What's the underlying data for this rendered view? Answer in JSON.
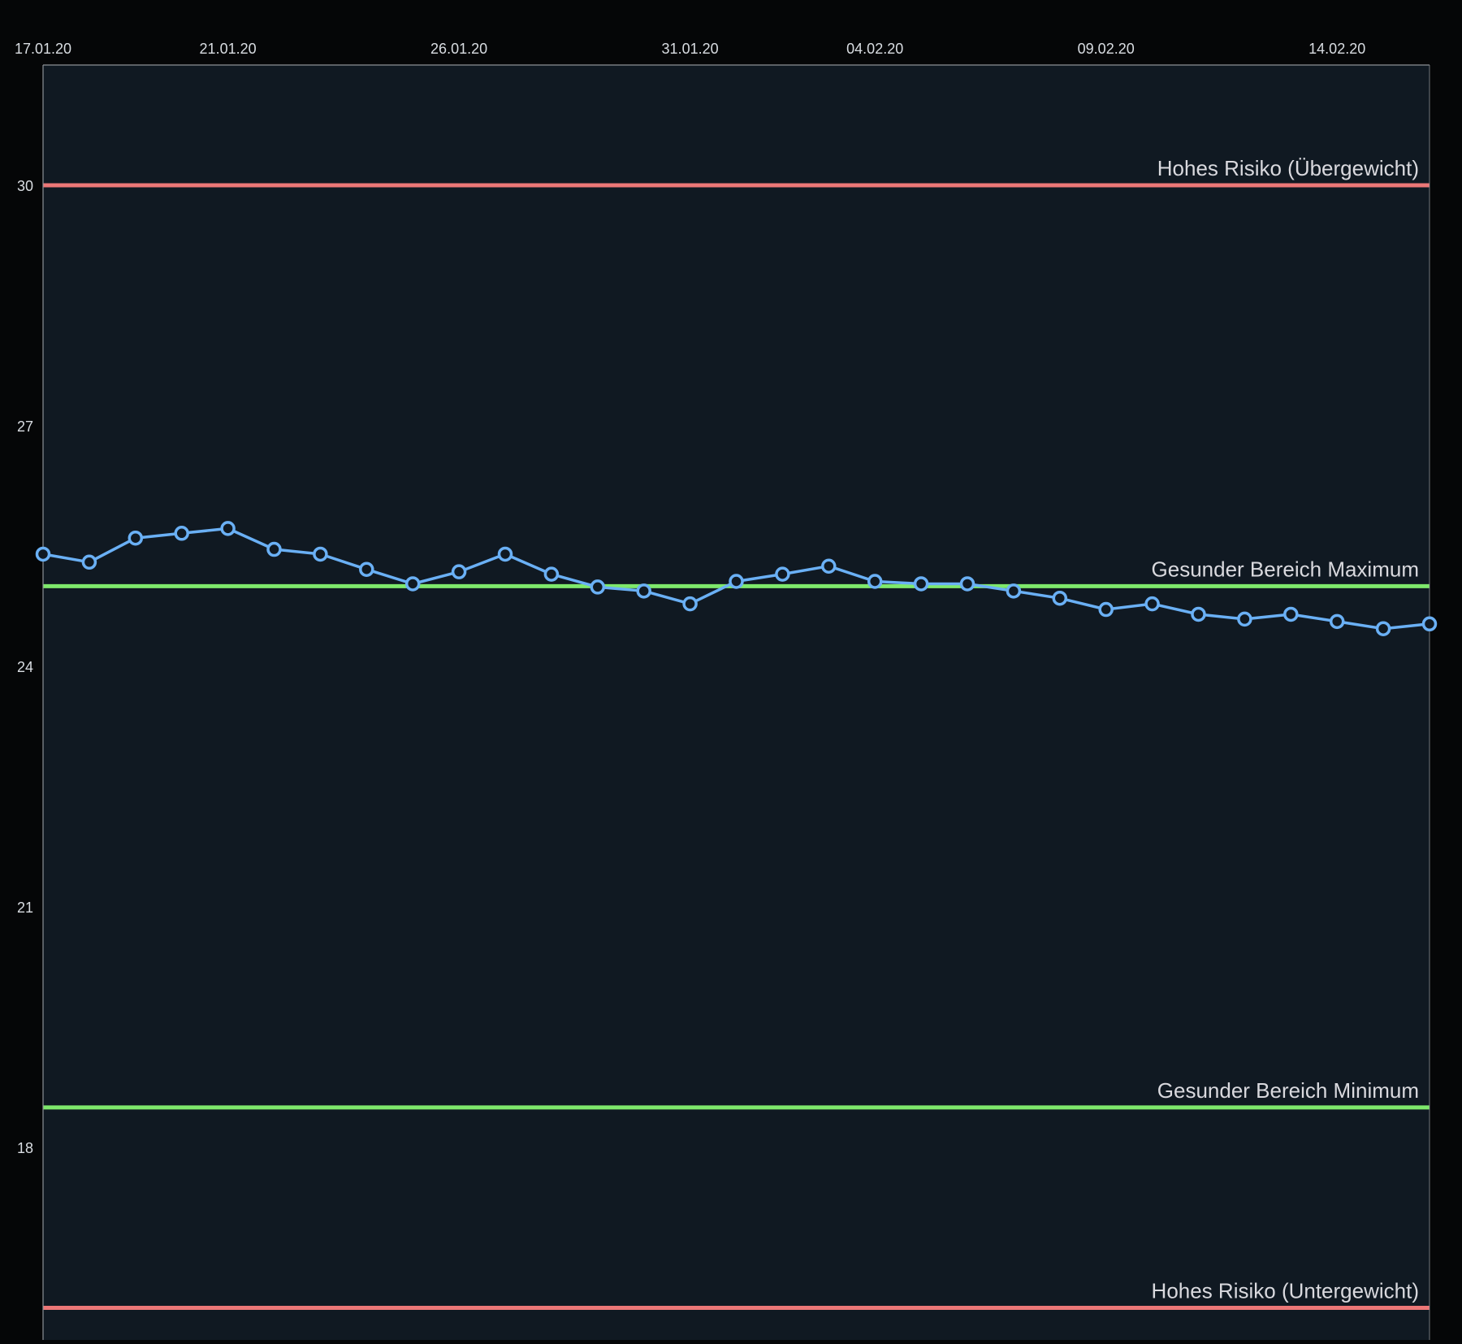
{
  "chart_data": {
    "type": "line",
    "title": "",
    "xlabel": "",
    "ylabel": "",
    "grid": false,
    "legend": "none",
    "x_axis_position": "top",
    "x": [
      "2020-01-17",
      "2020-01-18",
      "2020-01-19",
      "2020-01-20",
      "2020-01-21",
      "2020-01-22",
      "2020-01-23",
      "2020-01-24",
      "2020-01-25",
      "2020-01-26",
      "2020-01-27",
      "2020-01-28",
      "2020-01-29",
      "2020-01-30",
      "2020-01-31",
      "2020-02-01",
      "2020-02-02",
      "2020-02-03",
      "2020-02-04",
      "2020-02-05",
      "2020-02-06",
      "2020-02-07",
      "2020-02-08",
      "2020-02-09",
      "2020-02-10",
      "2020-02-11",
      "2020-02-12",
      "2020-02-13",
      "2020-02-14",
      "2020-02-15",
      "2020-02-16"
    ],
    "xlim": [
      "2020-01-17",
      "2020-02-16"
    ],
    "xticks": [
      {
        "value": "2020-01-17",
        "label": "17.01.20"
      },
      {
        "value": "2020-01-21",
        "label": "21.01.20"
      },
      {
        "value": "2020-01-26",
        "label": "26.01.20"
      },
      {
        "value": "2020-01-31",
        "label": "31.01.20"
      },
      {
        "value": "2020-02-04",
        "label": "04.02.20"
      },
      {
        "value": "2020-02-09",
        "label": "09.02.20"
      },
      {
        "value": "2020-02-14",
        "label": "14.02.20"
      }
    ],
    "ylim": [
      15.6,
      31.5
    ],
    "yticks": [
      {
        "value": 30,
        "label": "30"
      },
      {
        "value": 27,
        "label": "27"
      },
      {
        "value": 24,
        "label": "24"
      },
      {
        "value": 21,
        "label": "21"
      },
      {
        "value": 18,
        "label": "18"
      }
    ],
    "series": [
      {
        "color": "#6ab0f5",
        "values": [
          25.4,
          25.3,
          25.6,
          25.66,
          25.72,
          25.46,
          25.4,
          25.21,
          25.03,
          25.18,
          25.4,
          25.15,
          24.99,
          24.94,
          24.78,
          25.06,
          25.15,
          25.25,
          25.06,
          25.03,
          25.03,
          24.94,
          24.85,
          24.71,
          24.78,
          24.65,
          24.59,
          24.65,
          24.56,
          24.47,
          24.53
        ]
      }
    ],
    "reference_lines": [
      {
        "value": 30,
        "label": "Hohes Risiko (Übergewicht)",
        "color": "#ec7777"
      },
      {
        "value": 25,
        "label": "Gesunder Bereich Maximum",
        "color": "#7ee86b"
      },
      {
        "value": 18.5,
        "label": "Gesunder Bereich Minimum",
        "color": "#7ee86b"
      },
      {
        "value": 16,
        "label": "Hohes Risiko (Untergewicht)",
        "color": "#ec7777"
      }
    ],
    "colors": {
      "page_background": "#050607",
      "plot_background": "#101922",
      "axis": "#8d9196",
      "point_fill": "#101922"
    }
  }
}
